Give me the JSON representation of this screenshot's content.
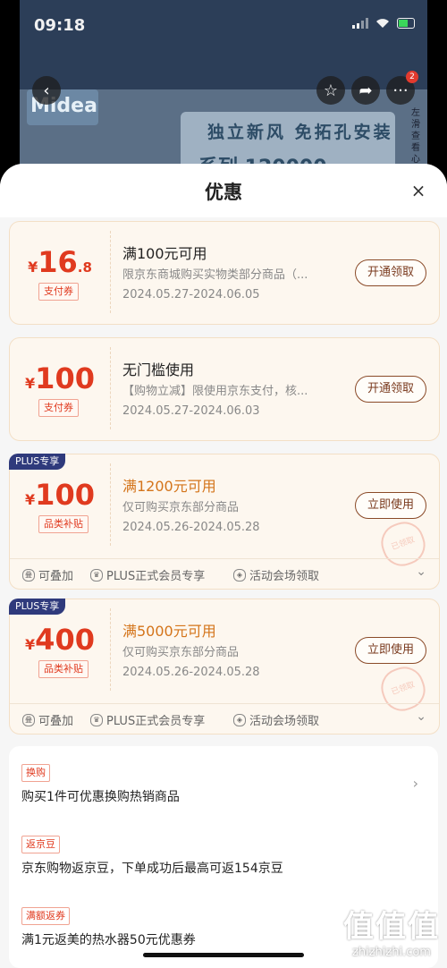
{
  "status": {
    "time": "09:18"
  },
  "product_page": {
    "brand": "Midea",
    "banner_text": "独立新风 免拓孔安装",
    "banner_sub": "系列 120000",
    "side_note": "左滑查看心动",
    "cart_badge": "2"
  },
  "sheet": {
    "title": "优惠",
    "close_icon": "×"
  },
  "coupons": [
    {
      "currency": "¥",
      "amount": "16",
      "decimal": ".8",
      "tag": "支付券",
      "title": "满100元可用",
      "desc": "限京东商城购买实物类部分商品（...",
      "date": "2024.05.27-2024.06.05",
      "button": "开通领取"
    },
    {
      "currency": "¥",
      "amount": "100",
      "tag": "支付券",
      "title": "无门槛使用",
      "desc": "【购物立减】限使用京东支付，核...",
      "date": "2024.05.27-2024.06.03",
      "button": "开通领取"
    },
    {
      "plus_label": "PLUS专享",
      "currency": "¥",
      "amount": "100",
      "tag": "品类补贴",
      "title": "满1200元可用",
      "desc": "仅可购买京东部分商品",
      "date": "2024.05.26-2024.05.28",
      "button": "立即使用",
      "stamp": "已领取",
      "perks": [
        "可叠加",
        "PLUS正式会员专享",
        "活动会场领取"
      ]
    },
    {
      "plus_label": "PLUS专享",
      "currency": "¥",
      "amount": "400",
      "tag": "品类补贴",
      "title": "满5000元可用",
      "desc": "仅可购买京东部分商品",
      "date": "2024.05.26-2024.05.28",
      "button": "立即使用",
      "stamp": "已领取",
      "perks": [
        "可叠加",
        "PLUS正式会员专享",
        "活动会场领取"
      ]
    }
  ],
  "info": [
    {
      "tag": "换购",
      "text": "购买1件可优惠换购热销商品"
    },
    {
      "tag": "返京豆",
      "text": "京东购物返京豆，下单成功后最高可返154京豆"
    },
    {
      "tag": "满额返券",
      "text": "满1元返美的热水器50元优惠券"
    }
  ],
  "watermark": {
    "big": "值值值",
    "small": "zhizhizhi.com"
  },
  "colors": {
    "accent_red": "#e03a1f",
    "plus_blue": "#2f3a7c",
    "coupon_bg": "#fdf7ef"
  }
}
